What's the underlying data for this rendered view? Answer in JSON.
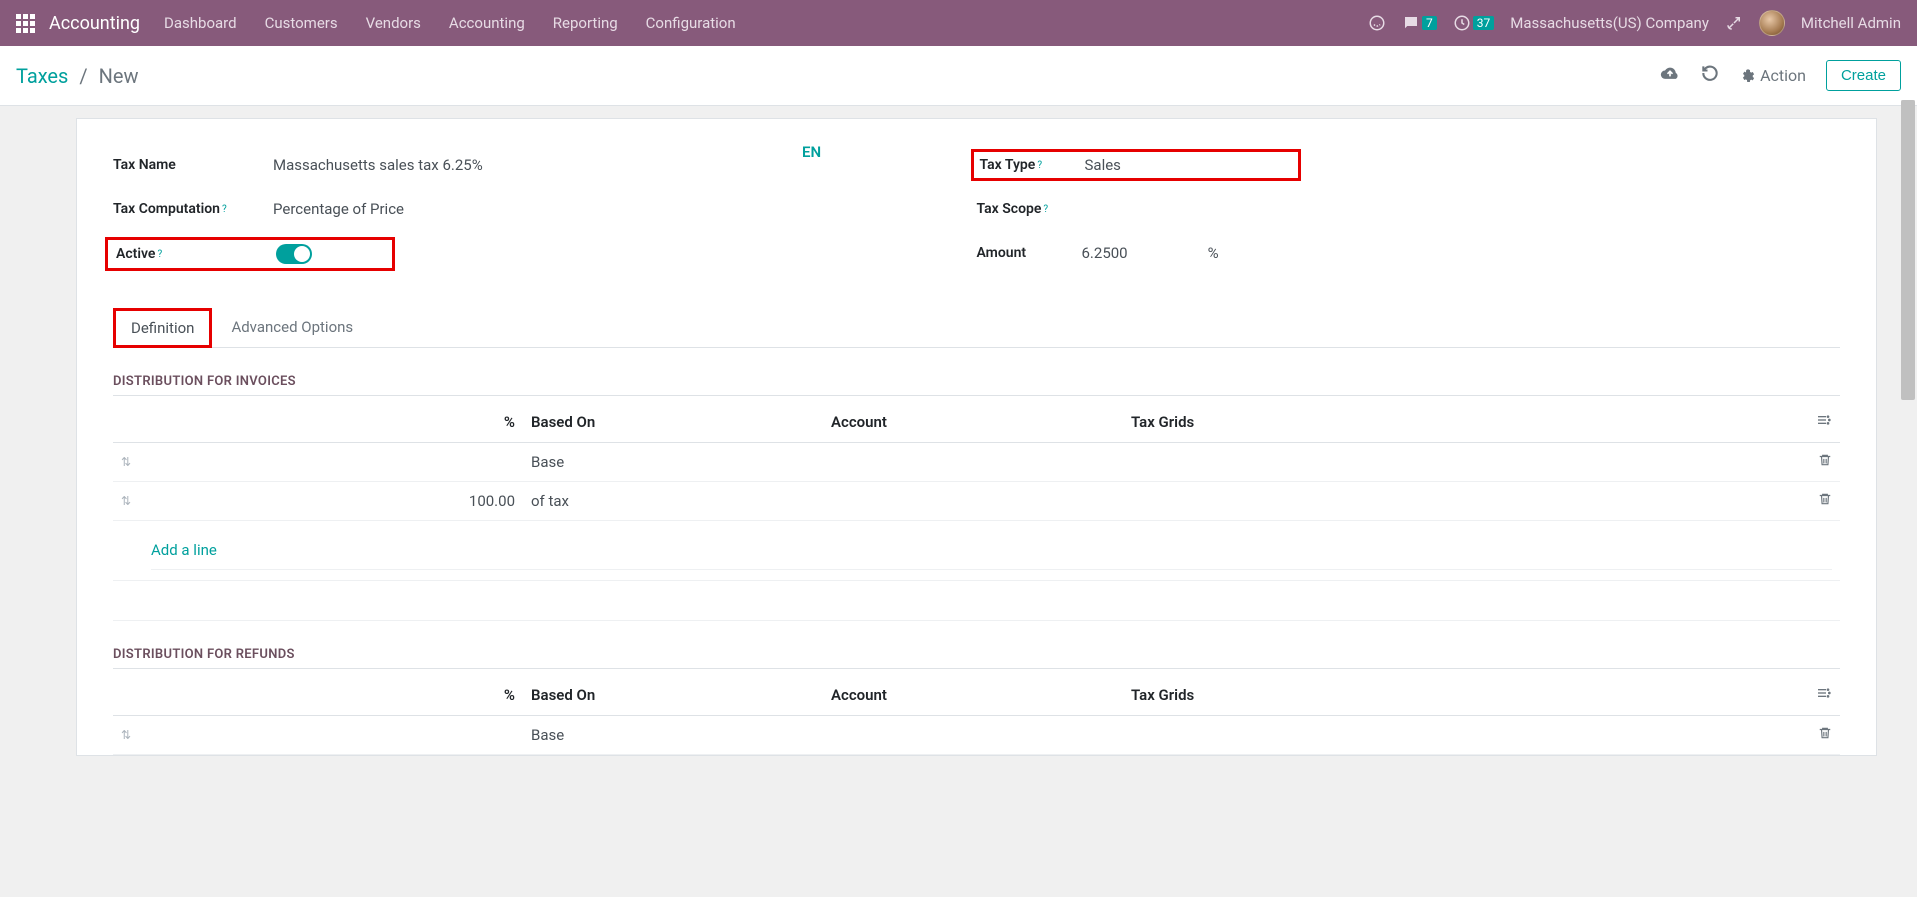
{
  "navbar": {
    "brand": "Accounting",
    "menu": [
      "Dashboard",
      "Customers",
      "Vendors",
      "Accounting",
      "Reporting",
      "Configuration"
    ],
    "messages_badge": "7",
    "activities_badge": "37",
    "company": "Massachusetts(US) Company",
    "username": "Mitchell Admin"
  },
  "toolbar": {
    "breadcrumb_root": "Taxes",
    "breadcrumb_sep": "/",
    "breadcrumb_current": "New",
    "action_label": "Action",
    "create_label": "Create"
  },
  "form": {
    "left": {
      "tax_name_label": "Tax Name",
      "tax_name_value": "Massachusetts sales tax 6.25%",
      "tax_comp_label": "Tax Computation",
      "tax_comp_value": "Percentage of Price",
      "active_label": "Active"
    },
    "right": {
      "tax_type_label": "Tax Type",
      "tax_type_value": "Sales",
      "tax_scope_label": "Tax Scope",
      "tax_scope_value": "",
      "amount_label": "Amount",
      "amount_value": "6.2500",
      "amount_suffix": "%"
    },
    "lang": "EN"
  },
  "tabs": {
    "definition": "Definition",
    "advanced": "Advanced Options"
  },
  "dist_inv": {
    "title": "DISTRIBUTION FOR INVOICES",
    "headers": {
      "pct": "%",
      "based_on": "Based On",
      "account": "Account",
      "tax_grids": "Tax Grids"
    },
    "rows": [
      {
        "pct": "",
        "based_on": "Base"
      },
      {
        "pct": "100.00",
        "based_on": "of tax"
      }
    ],
    "add_line": "Add a line"
  },
  "dist_ref": {
    "title": "DISTRIBUTION FOR REFUNDS",
    "headers": {
      "pct": "%",
      "based_on": "Based On",
      "account": "Account",
      "tax_grids": "Tax Grids"
    },
    "rows": [
      {
        "pct": "",
        "based_on": "Base"
      }
    ]
  }
}
